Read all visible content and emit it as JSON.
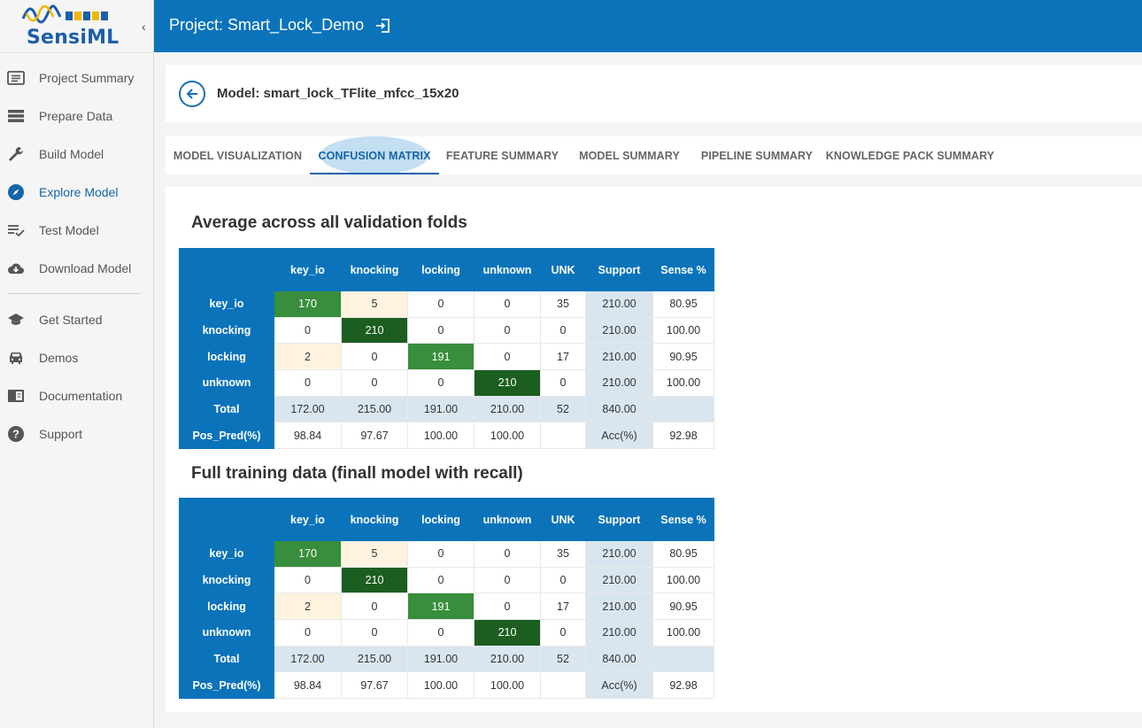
{
  "app": {
    "logo_text": "SensiML"
  },
  "sidebar": {
    "items": [
      {
        "label": "Project Summary"
      },
      {
        "label": "Prepare Data"
      },
      {
        "label": "Build Model"
      },
      {
        "label": "Explore Model"
      },
      {
        "label": "Test Model"
      },
      {
        "label": "Download Model"
      },
      {
        "label": "Get Started"
      },
      {
        "label": "Demos"
      },
      {
        "label": "Documentation"
      },
      {
        "label": "Support"
      }
    ],
    "active": "Explore Model"
  },
  "header": {
    "title": "Project: Smart_Lock_Demo"
  },
  "model": {
    "title": "Model: smart_lock_TFlite_mfcc_15x20"
  },
  "tabs": [
    {
      "label": "MODEL VISUALIZATION"
    },
    {
      "label": "CONFUSION MATRIX"
    },
    {
      "label": "FEATURE SUMMARY"
    },
    {
      "label": "MODEL SUMMARY"
    },
    {
      "label": "PIPELINE SUMMARY"
    },
    {
      "label": "KNOWLEDGE PACK SUMMARY"
    }
  ],
  "active_tab": "CONFUSION MATRIX",
  "matrices": [
    {
      "title": "Average across all validation folds",
      "headers": [
        "",
        "key_io",
        "knocking",
        "locking",
        "unknown",
        "UNK",
        "Support",
        "Sense %"
      ],
      "rows": [
        {
          "label": "key_io",
          "cells": [
            "170",
            "5",
            "0",
            "0",
            "35",
            "210.00",
            "80.95"
          ]
        },
        {
          "label": "knocking",
          "cells": [
            "0",
            "210",
            "0",
            "0",
            "0",
            "210.00",
            "100.00"
          ]
        },
        {
          "label": "locking",
          "cells": [
            "2",
            "0",
            "191",
            "0",
            "17",
            "210.00",
            "90.95"
          ]
        },
        {
          "label": "unknown",
          "cells": [
            "0",
            "0",
            "0",
            "210",
            "0",
            "210.00",
            "100.00"
          ]
        },
        {
          "label": "Total",
          "cells": [
            "172.00",
            "215.00",
            "191.00",
            "210.00",
            "52",
            "840.00",
            ""
          ]
        },
        {
          "label": "Pos_Pred(%)",
          "cells": [
            "98.84",
            "97.67",
            "100.00",
            "100.00",
            "",
            "Acc(%)",
            "92.98"
          ]
        }
      ]
    },
    {
      "title": "Full training data (finall model with recall)",
      "headers": [
        "",
        "key_io",
        "knocking",
        "locking",
        "unknown",
        "UNK",
        "Support",
        "Sense %"
      ],
      "rows": [
        {
          "label": "key_io",
          "cells": [
            "170",
            "5",
            "0",
            "0",
            "35",
            "210.00",
            "80.95"
          ]
        },
        {
          "label": "knocking",
          "cells": [
            "0",
            "210",
            "0",
            "0",
            "0",
            "210.00",
            "100.00"
          ]
        },
        {
          "label": "locking",
          "cells": [
            "2",
            "0",
            "191",
            "0",
            "17",
            "210.00",
            "90.95"
          ]
        },
        {
          "label": "unknown",
          "cells": [
            "0",
            "0",
            "0",
            "210",
            "0",
            "210.00",
            "100.00"
          ]
        },
        {
          "label": "Total",
          "cells": [
            "172.00",
            "215.00",
            "191.00",
            "210.00",
            "52",
            "840.00",
            ""
          ]
        },
        {
          "label": "Pos_Pred(%)",
          "cells": [
            "98.84",
            "97.67",
            "100.00",
            "100.00",
            "",
            "Acc(%)",
            "92.98"
          ]
        }
      ]
    }
  ],
  "colors": {
    "header_blue": "#0a73ba",
    "active_blue": "#1565a8",
    "dark_green": "#1b5e20",
    "medium_green": "#388e3c",
    "light_orange": "#fff3e0",
    "support_gray": "#dae6ef"
  }
}
